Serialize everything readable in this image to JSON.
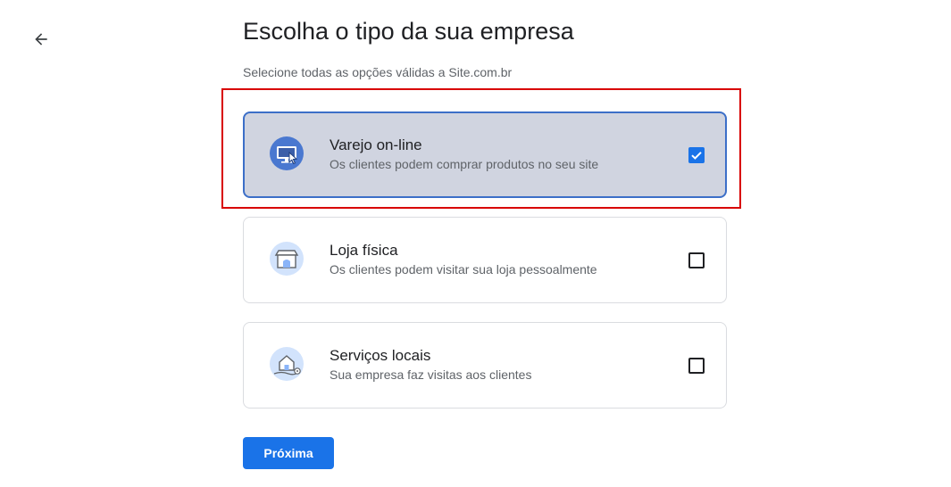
{
  "header": {
    "back_icon": "arrow-back-icon",
    "title": "Escolha o tipo da sua empresa",
    "subtitle": "Selecione todas as opções válidas a Site.com.br"
  },
  "options": [
    {
      "title": "Varejo on-line",
      "description": "Os clientes podem comprar produtos no seu site",
      "icon": "online-store-icon",
      "checked": true
    },
    {
      "title": "Loja física",
      "description": "Os clientes podem visitar sua loja pessoalmente",
      "icon": "physical-store-icon",
      "checked": false
    },
    {
      "title": "Serviços locais",
      "description": "Sua empresa faz visitas aos clientes",
      "icon": "local-services-icon",
      "checked": false
    }
  ],
  "footer": {
    "next_label": "Próxima"
  },
  "colors": {
    "accent": "#1a73e8",
    "selected_background": "#d0d4e0",
    "selected_border": "#3c6fc8",
    "highlight": "#d80000"
  }
}
